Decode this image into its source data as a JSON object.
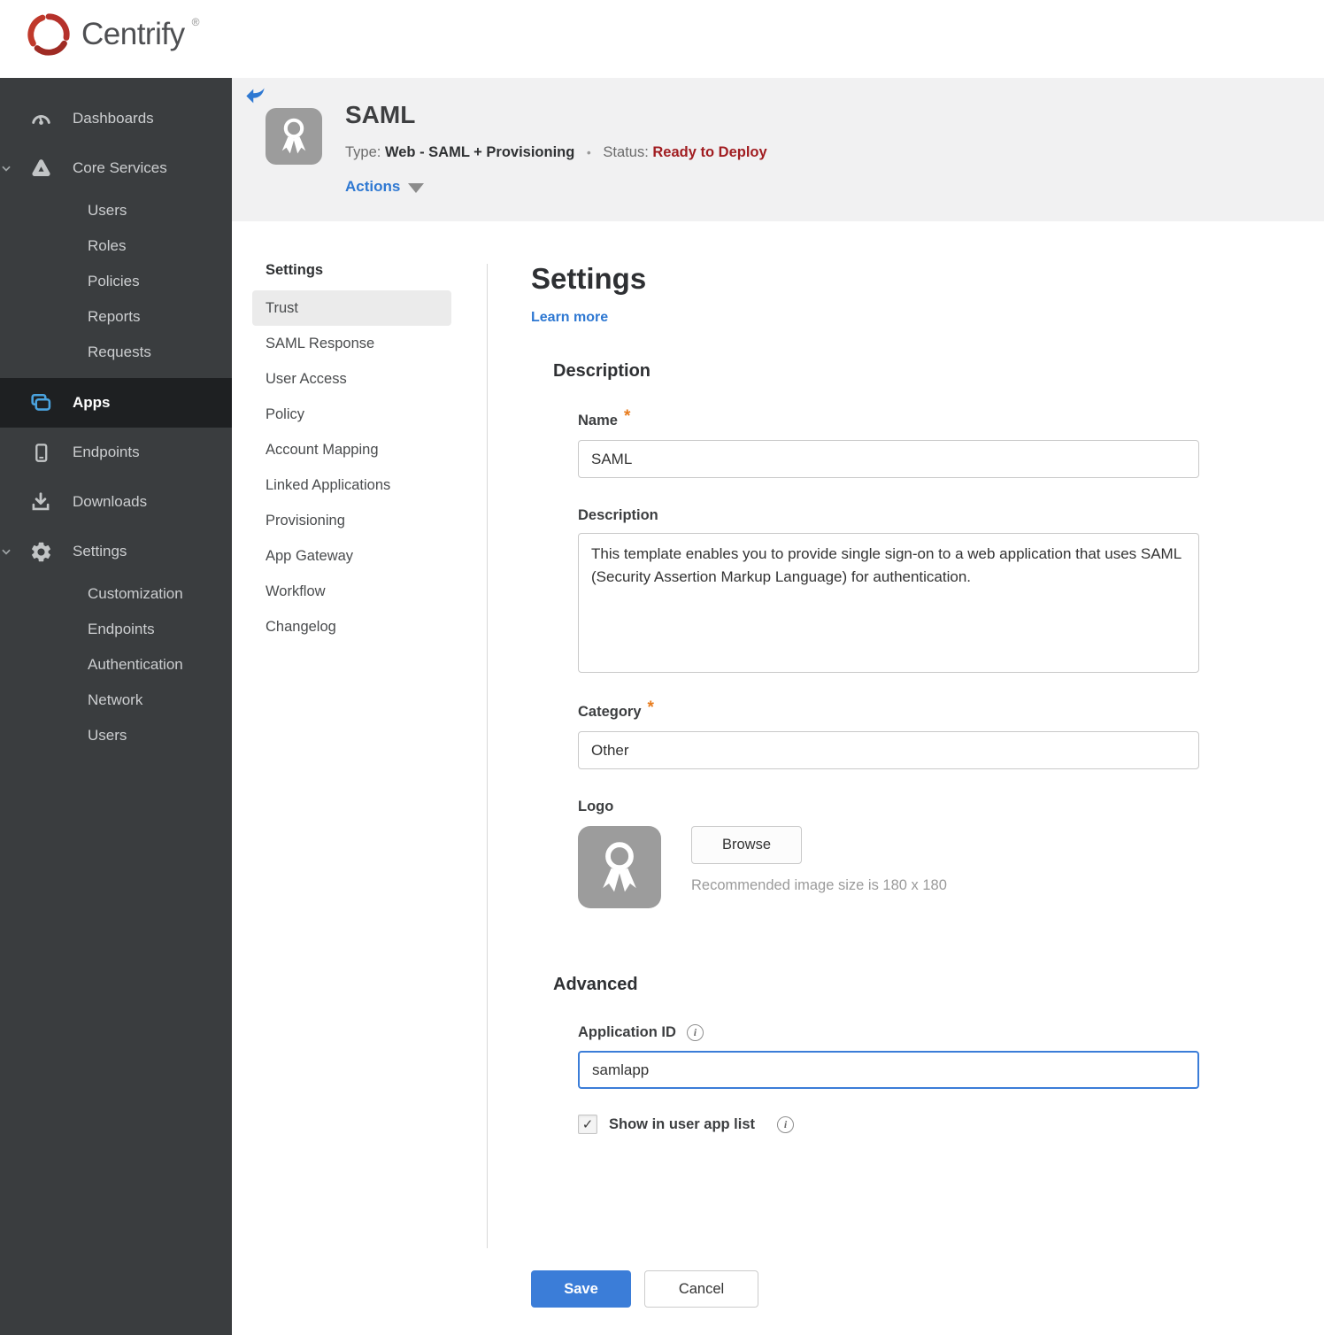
{
  "brand": {
    "name": "Centrify",
    "registered": "®"
  },
  "icons": {
    "check": "✓",
    "info": "i"
  },
  "colors": {
    "brand_red": "#b5312b",
    "link_blue": "#2e78d2",
    "save_blue": "#3b7dd8",
    "status_red": "#a11d21",
    "sidebar_bg": "#3a3d3f",
    "sidebar_active_bg": "#1e2022",
    "header_band_bg": "#f1f1f2",
    "required_orange": "#e87c1e",
    "apps_icon_blue": "#4aa3df"
  },
  "sidebar": {
    "dashboards": "Dashboards",
    "core_services": "Core Services",
    "core_children": [
      "Users",
      "Roles",
      "Policies",
      "Reports",
      "Requests"
    ],
    "apps": "Apps",
    "endpoints": "Endpoints",
    "downloads": "Downloads",
    "settings": "Settings",
    "settings_children": [
      "Customization",
      "Endpoints",
      "Authentication",
      "Network",
      "Users"
    ]
  },
  "header": {
    "title": "SAML",
    "type_label": "Type:",
    "type_value": "Web - SAML + Provisioning",
    "dot": "•",
    "status_label": "Status:",
    "status_value": "Ready to Deploy",
    "actions": "Actions"
  },
  "subnav": {
    "heading": "Settings",
    "active_item": "Trust",
    "items": [
      "Trust",
      "SAML Response",
      "User Access",
      "Policy",
      "Account Mapping",
      "Linked Applications",
      "Provisioning",
      "App Gateway",
      "Workflow",
      "Changelog"
    ]
  },
  "form": {
    "title": "Settings",
    "learn_more": "Learn more",
    "description": {
      "heading": "Description",
      "name_label": "Name",
      "required_mark": "*",
      "name_value": "SAML",
      "desc_label": "Description",
      "desc_value": "This template enables you to provide single sign-on to a web application that uses SAML (Security Assertion Markup Language) for authentication.",
      "category_label": "Category",
      "category_value": "Other",
      "logo_label": "Logo",
      "browse_button": "Browse",
      "logo_hint": "Recommended image size is 180 x 180"
    },
    "advanced": {
      "heading": "Advanced",
      "app_id_label": "Application ID",
      "app_id_value": "samlapp",
      "show_label": "Show in user app list",
      "show_checked": true
    },
    "save_button": "Save",
    "cancel_button": "Cancel"
  }
}
